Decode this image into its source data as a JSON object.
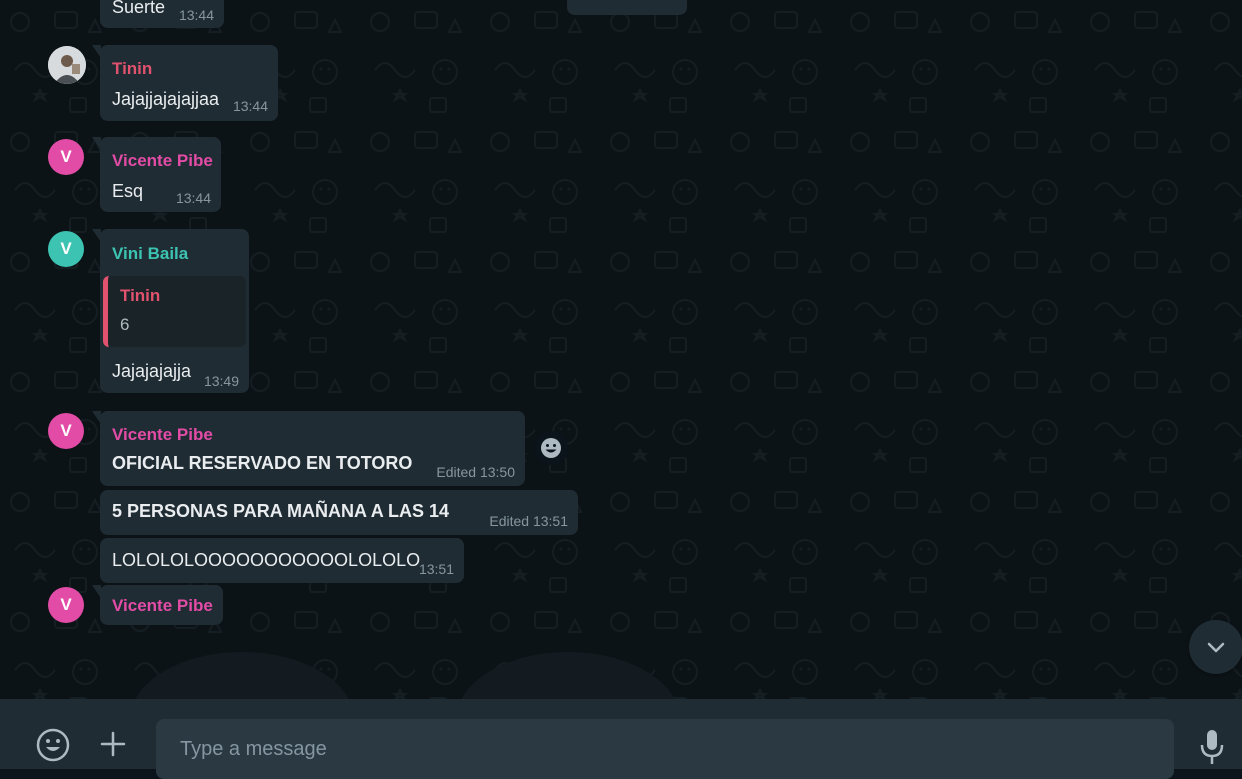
{
  "colors": {
    "background": "#0c1317",
    "bubble": "#202c33",
    "tinin": "#e0526d",
    "vicente": "#e24ca6",
    "vini": "#3cc3b2",
    "timestamp": "#8696a0"
  },
  "messages": [
    {
      "text": "Suerte",
      "time": "13:44"
    },
    {
      "sender": "Tinin",
      "text": "Jajajjajajajjaa",
      "time": "13:44"
    },
    {
      "sender": "Vicente Pibe",
      "avatar": "V",
      "text": "Esq",
      "time": "13:44"
    },
    {
      "sender": "Vini Baila",
      "avatar": "V",
      "quote": {
        "sender": "Tinin",
        "text": "6"
      },
      "text": "Jajajajajja",
      "time": "13:49"
    },
    {
      "sender": "Vicente Pibe",
      "avatar": "V",
      "text": "OFICIAL RESERVADO EN TOTORO",
      "edited": "Edited",
      "time": "13:50"
    },
    {
      "text": "5 PERSONAS PARA MAÑANA A LAS 14",
      "edited": "Edited",
      "time": "13:51"
    },
    {
      "text": "LOLOLOLOOOOOOOOOOOLOLOLO",
      "time": "13:51"
    },
    {
      "sender": "Vicente Pibe",
      "avatar": "V"
    }
  ],
  "composer": {
    "placeholder": "Type a message",
    "emoji_icon": "smiley-icon",
    "attach_icon": "plus-icon",
    "mic_icon": "microphone-icon"
  },
  "scroll_down_icon": "chevron-down-icon",
  "reaction_icon": "smiley-icon"
}
